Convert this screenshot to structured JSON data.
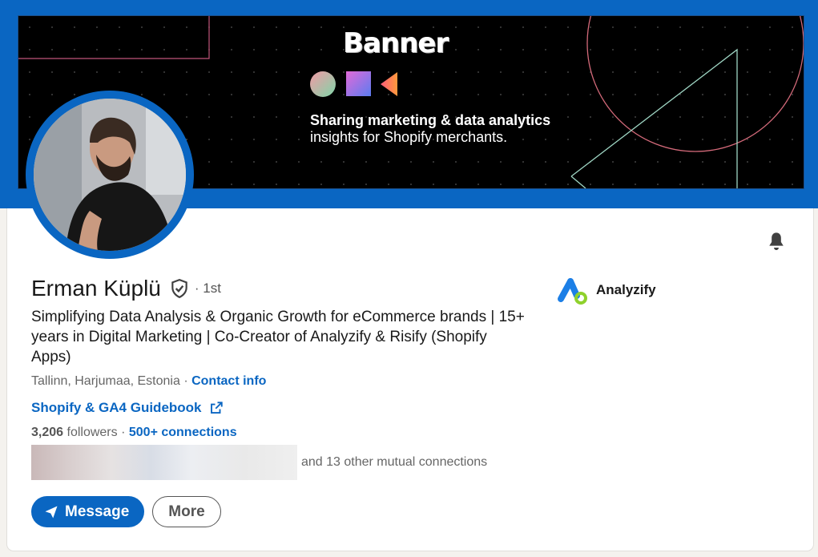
{
  "banner": {
    "title": "Banner",
    "line1": "Sharing marketing & data analytics",
    "line2": "insights for Shopify merchants."
  },
  "profile": {
    "name": "Erman Küplü",
    "degree": "· 1st",
    "headline": "Simplifying Data Analysis & Organic Growth for eCommerce brands | 15+ years in Digital Marketing | Co-Creator of Analyzify & Risify (Shopify Apps)",
    "location": "Tallinn, Harjumaa, Estonia ·",
    "contact_info": "Contact info",
    "website": "Shopify & GA4 Guidebook",
    "followers_count": "3,206",
    "followers_label": "followers",
    "connections": "500+ connections",
    "mutual_text": "and 13 other mutual connections"
  },
  "company": {
    "name": "Analyzify"
  },
  "actions": {
    "message": "Message",
    "more": "More"
  },
  "colors": {
    "accent": "#0a66c2",
    "banner_bg": "#000000"
  }
}
